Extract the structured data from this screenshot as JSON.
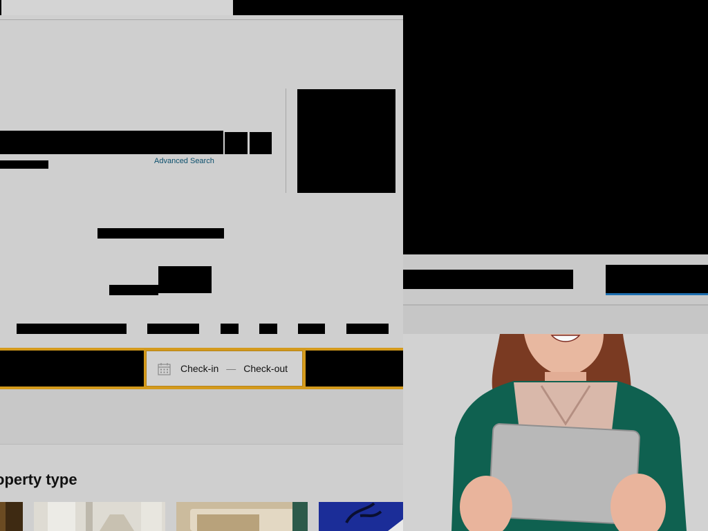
{
  "search": {
    "advanced_label": "Advanced Search"
  },
  "booking": {
    "checkin_label": "Check-in",
    "dash": "—",
    "checkout_label": "Check-out"
  },
  "sections": {
    "property_type_title": "operty type"
  },
  "icons": {
    "date": "calendar-icon"
  },
  "colors": {
    "booking_border": "#d49a1c",
    "link": "#0b4f6c",
    "accent_underline": "#1e6fb0"
  }
}
